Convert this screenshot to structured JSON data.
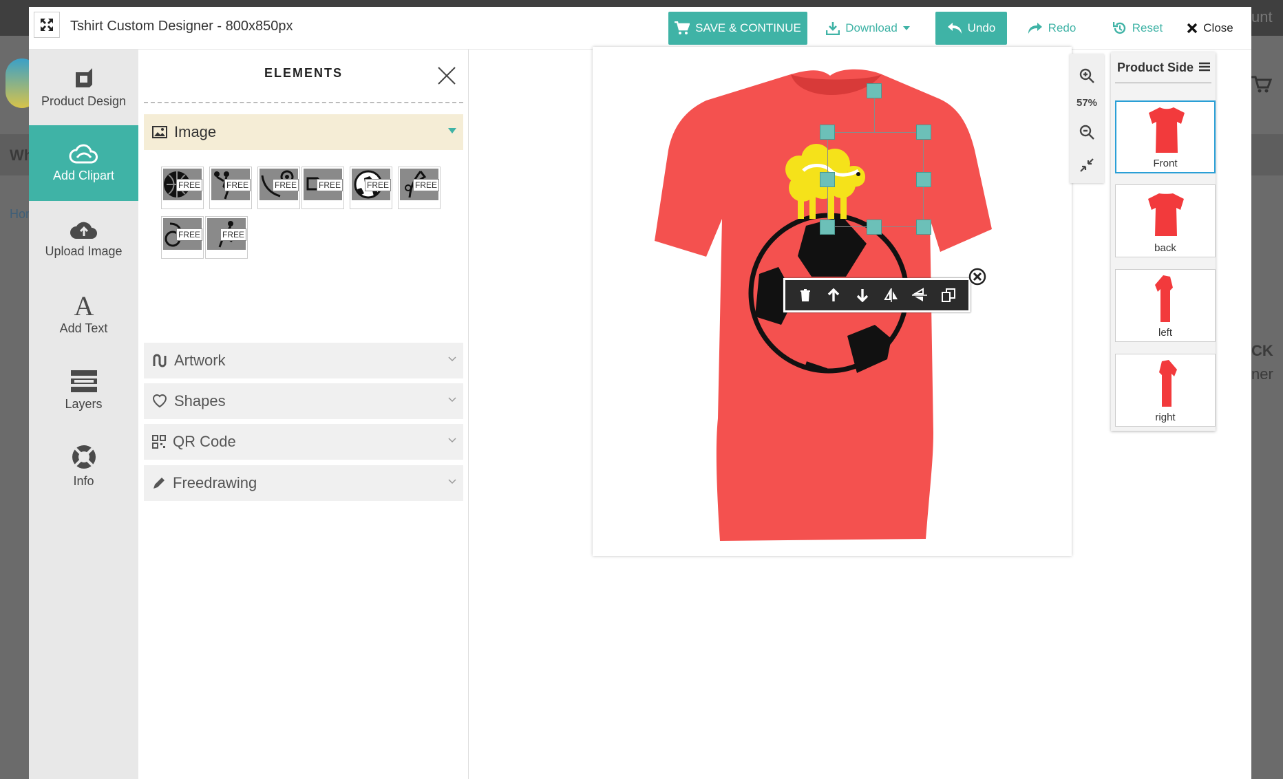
{
  "background": {
    "frag_wh": "Wh",
    "frag_hom": "Hom",
    "frag_ck": "CK",
    "frag_ner": "ner",
    "frag_unt": "unt"
  },
  "window": {
    "title": "Tshirt Custom Designer - 800x850px"
  },
  "toolbar": {
    "save_label": "SAVE & CONTINUE",
    "download_label": "Download",
    "undo_label": "Undo",
    "redo_label": "Redo",
    "reset_label": "Reset",
    "close_label": "Close"
  },
  "nav": {
    "items": [
      {
        "label": "Product Design",
        "icon": "product-design-icon"
      },
      {
        "label": "Add Clipart",
        "icon": "cloud-clipart-icon"
      },
      {
        "label": "Upload Image",
        "icon": "cloud-upload-icon"
      },
      {
        "label": "Add Text",
        "icon": "text-a-icon"
      },
      {
        "label": "Layers",
        "icon": "layers-icon"
      },
      {
        "label": "Info",
        "icon": "lifebuoy-icon"
      }
    ]
  },
  "panel": {
    "title": "ELEMENTS",
    "sections": [
      {
        "label": "Image",
        "icon": "image-icon",
        "open": true
      },
      {
        "label": "Artwork",
        "icon": "artwork-icon",
        "open": false
      },
      {
        "label": "Shapes",
        "icon": "heart-icon",
        "open": false
      },
      {
        "label": "QR Code",
        "icon": "qr-code-icon",
        "open": false
      },
      {
        "label": "Freedrawing",
        "icon": "pencil-icon",
        "open": false
      }
    ],
    "clipart_badge": "FREE",
    "clipart_count": 8
  },
  "canvas": {
    "product": "t-shirt",
    "shirt_color": "#f4514f",
    "zoom": "57%"
  },
  "product_sides": {
    "title": "Product Side",
    "items": [
      {
        "label": "Front",
        "selected": true
      },
      {
        "label": "back",
        "selected": false
      },
      {
        "label": "left",
        "selected": false
      },
      {
        "label": "right",
        "selected": false
      }
    ]
  },
  "colors": {
    "accent": "#3fb3a6",
    "selected_side_border": "#2a9fd6",
    "open_section": "#f5edd6",
    "sheep": "#f5e21a"
  }
}
